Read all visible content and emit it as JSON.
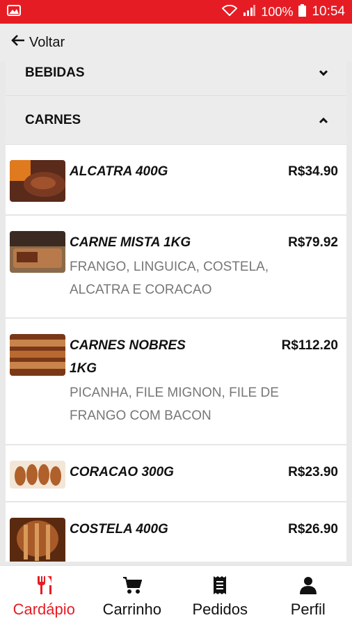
{
  "status_bar": {
    "wifi_icon": "wifi-icon",
    "signal_icon": "signal-icon",
    "battery": "100%",
    "time": "10:54"
  },
  "top_bar": {
    "back_label": "Voltar"
  },
  "categories": {
    "bebidas": {
      "label": "BEBIDAS"
    },
    "carnes": {
      "label": "CARNES"
    }
  },
  "items": [
    {
      "name": "ALCATRA 400G",
      "price": "R$34.90"
    },
    {
      "name": "CARNE MISTA 1KG",
      "price": "R$79.92",
      "desc_line1": "FRANGO, LINGUICA, COSTELA,",
      "desc_line2": "ALCATRA E CORACAO"
    },
    {
      "name_line1": "CARNES NOBRES",
      "name_line2": "1KG",
      "price": "R$112.20",
      "desc_line1": "PICANHA, FILE MIGNON, FILE DE",
      "desc_line2": "FRANGO COM BACON"
    },
    {
      "name": "CORACAO 300G",
      "price": "R$23.90"
    },
    {
      "name": "COSTELA 400G",
      "price": "R$26.90"
    }
  ],
  "bottom_nav": [
    {
      "label": "Cardápio",
      "icon": "utensils-icon",
      "active": true
    },
    {
      "label": "Carrinho",
      "icon": "cart-icon"
    },
    {
      "label": "Pedidos",
      "icon": "receipt-icon"
    },
    {
      "label": "Perfil",
      "icon": "user-icon"
    }
  ],
  "colors": {
    "accent": "#e61c24"
  }
}
